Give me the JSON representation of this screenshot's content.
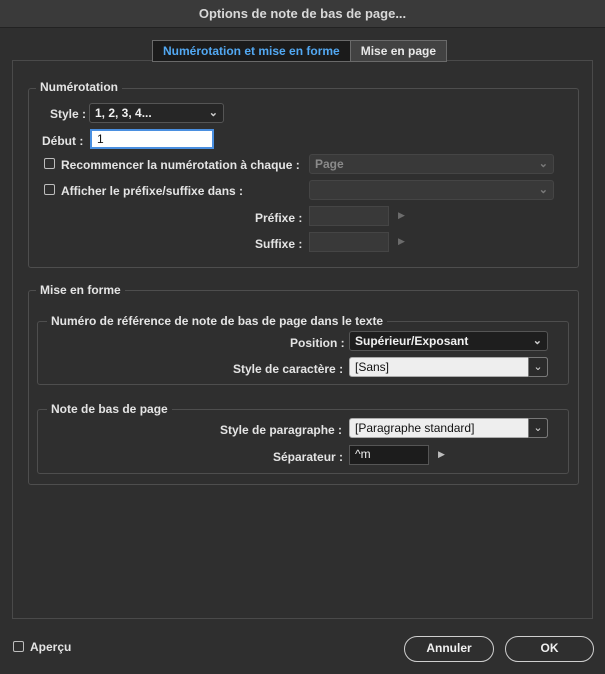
{
  "window": {
    "title": "Options de note de bas de page..."
  },
  "tabs": [
    {
      "label": "Numérotation et mise en forme"
    },
    {
      "label": "Mise en page"
    }
  ],
  "numerotation": {
    "title": "Numérotation",
    "style_label": "Style :",
    "style_value": "1, 2, 3, 4...",
    "debut_label": "Début :",
    "debut_value": "1",
    "restart_label": "Recommencer la numérotation à chaque :",
    "restart_value": "Page",
    "prefix_suffix_label": "Afficher le préfixe/suffixe dans :",
    "prefix_suffix_value": "",
    "prefixe_label": "Préfixe :",
    "suffixe_label": "Suffixe :"
  },
  "mise_en_forme": {
    "title": "Mise en forme",
    "reference": {
      "title": "Numéro de référence de note de bas de page dans le texte",
      "position_label": "Position :",
      "position_value": "Supérieur/Exposant",
      "char_style_label": "Style de caractère :",
      "char_style_value": "[Sans]"
    },
    "note": {
      "title": "Note de bas de page",
      "para_style_label": "Style de paragraphe :",
      "para_style_value": "[Paragraphe standard]",
      "separator_label": "Séparateur :",
      "separator_value": "^m"
    }
  },
  "footer": {
    "apercu_label": "Aperçu",
    "cancel_label": "Annuler",
    "ok_label": "OK"
  },
  "colors": {
    "accent": "#52a8f2",
    "background": "#2f2f2f"
  }
}
